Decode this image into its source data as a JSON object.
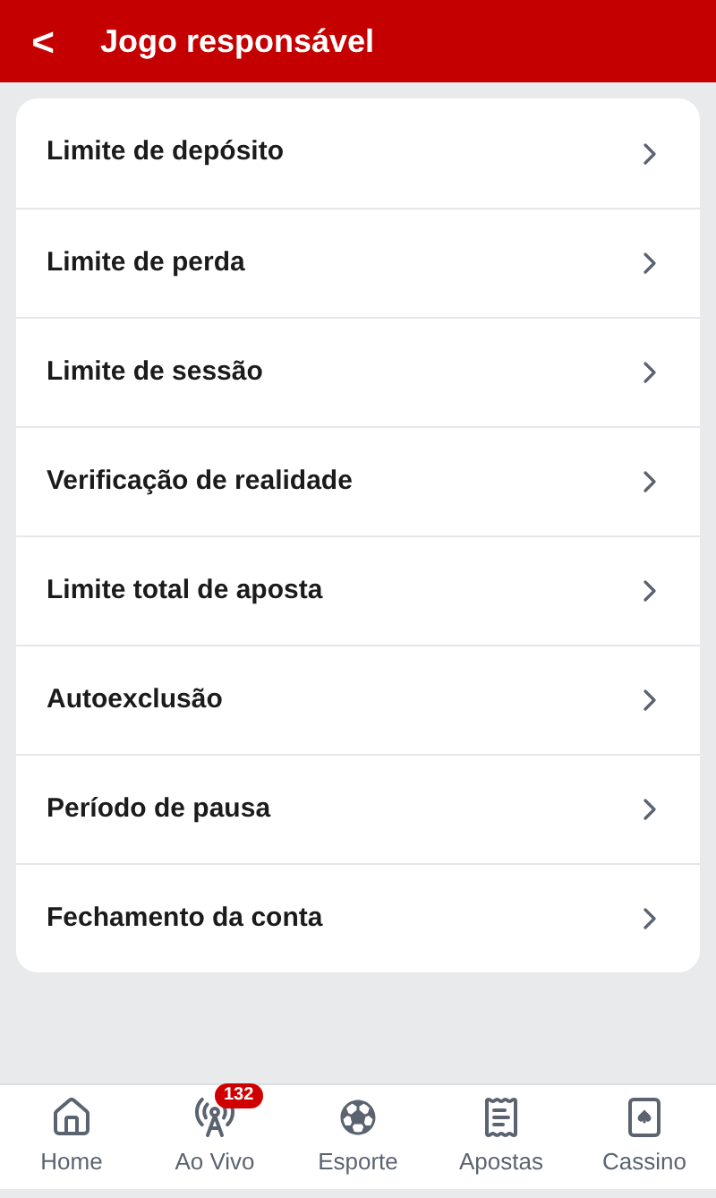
{
  "header": {
    "back": "<",
    "title": "Jogo responsável"
  },
  "menu": [
    {
      "label": "Limite de depósito"
    },
    {
      "label": "Limite de perda"
    },
    {
      "label": "Limite de sessão"
    },
    {
      "label": "Verificação de realidade"
    },
    {
      "label": "Limite total de aposta"
    },
    {
      "label": "Autoexclusão"
    },
    {
      "label": "Período de pausa"
    },
    {
      "label": "Fechamento da conta"
    }
  ],
  "bottom_nav": [
    {
      "kind": "home",
      "label": "Home"
    },
    {
      "kind": "live",
      "label": "Ao Vivo",
      "badge": "132"
    },
    {
      "kind": "sport",
      "label": "Esporte"
    },
    {
      "kind": "bets",
      "label": "Apostas"
    },
    {
      "kind": "casino",
      "label": "Cassino"
    }
  ]
}
